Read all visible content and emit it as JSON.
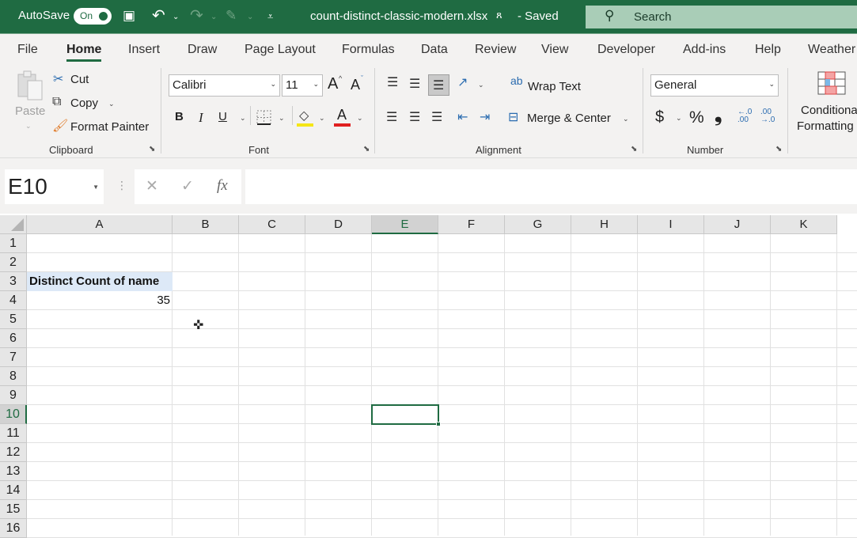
{
  "titlebar": {
    "autosave_label": "AutoSave",
    "autosave_state": "On",
    "filename": "count-distinct-classic-modern.xlsx",
    "save_status": "- Saved",
    "search_placeholder": "Search",
    "icons": {
      "save": "▣",
      "undo": "↶",
      "redo": "↷",
      "touch": "✎",
      "customize": "⩡",
      "person": "ጸ",
      "search": "⚲"
    }
  },
  "tabs": [
    "File",
    "Home",
    "Insert",
    "Draw",
    "Page Layout",
    "Formulas",
    "Data",
    "Review",
    "View",
    "Developer",
    "Add-ins",
    "Help",
    "Weather"
  ],
  "active_tab": "Home",
  "ribbon": {
    "clipboard": {
      "label": "Clipboard",
      "paste": "Paste",
      "cut": "Cut",
      "copy": "Copy",
      "format_painter": "Format Painter"
    },
    "font": {
      "label": "Font",
      "font_name": "Calibri",
      "font_size": "11",
      "bold": "B",
      "italic": "I",
      "underline": "U",
      "grow": "A",
      "shrink": "A",
      "font_color": "A",
      "fill_color_hex": "#f5e616",
      "font_color_hex": "#e02020"
    },
    "alignment": {
      "label": "Alignment",
      "wrap_text": "Wrap Text",
      "merge_center": "Merge & Center"
    },
    "number": {
      "label": "Number",
      "format": "General",
      "currency": "$",
      "percent": "%",
      "comma": "❟",
      "inc_decimal": "←.0 .00",
      "dec_decimal": ".00 →.0"
    },
    "styles": {
      "conditional_formatting_1": "Conditional",
      "conditional_formatting_2": "Formatting"
    }
  },
  "formula_bar": {
    "name_box": "E10",
    "cancel": "✕",
    "enter": "✓",
    "fx": "fx",
    "formula": ""
  },
  "sheet": {
    "columns": [
      "A",
      "B",
      "C",
      "D",
      "E",
      "F",
      "G",
      "H",
      "I",
      "J",
      "K"
    ],
    "rows": [
      "1",
      "2",
      "3",
      "4",
      "5",
      "6",
      "7",
      "8",
      "9",
      "10",
      "11",
      "12",
      "13",
      "14",
      "15",
      "16"
    ],
    "selected_cell": "E10",
    "cells": {
      "A3": "Distinct Count of name",
      "A4": "35"
    }
  },
  "accent_hex": "#1f6b42"
}
